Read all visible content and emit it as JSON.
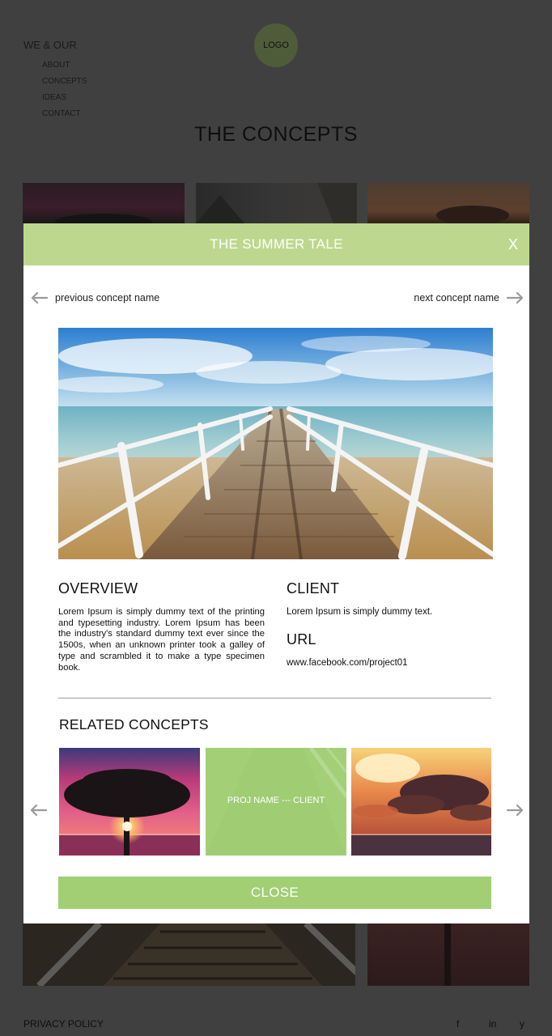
{
  "background": {
    "nav_title": "WE & OUR",
    "nav_items": [
      "ABOUT",
      "CONCEPTS",
      "IDEAS",
      "CONTACT"
    ],
    "logo": "LOGO",
    "page_title": "THE CONCEPTS",
    "footer": {
      "privacy": "PRIVACY POLICY",
      "social": [
        "f",
        "in",
        "y"
      ]
    }
  },
  "modal": {
    "title": "THE SUMMER TALE",
    "close_x": "X",
    "prev_label": "previous concept name",
    "next_label": "next concept name",
    "overview": {
      "heading": "OVERVIEW",
      "text": "Lorem Ipsum is simply dummy text of the printing and typesetting industry. Lorem Ipsum has been the industry's standard dummy text ever since the 1500s, when an unknown printer took a galley of type and scrambled it to make a type specimen book."
    },
    "client": {
      "heading": "CLIENT",
      "text": "Lorem Ipsum is simply dummy text."
    },
    "url": {
      "heading": "URL",
      "text": "www.facebook.com/project01"
    },
    "related": {
      "heading": "RELATED CONCEPTS",
      "hover_label": "PROJ NAME --- CLIENT"
    },
    "close_button": "CLOSE"
  },
  "colors": {
    "header_green": "#bdd88e",
    "button_green": "#a2cf74",
    "overlay": "#404040"
  }
}
